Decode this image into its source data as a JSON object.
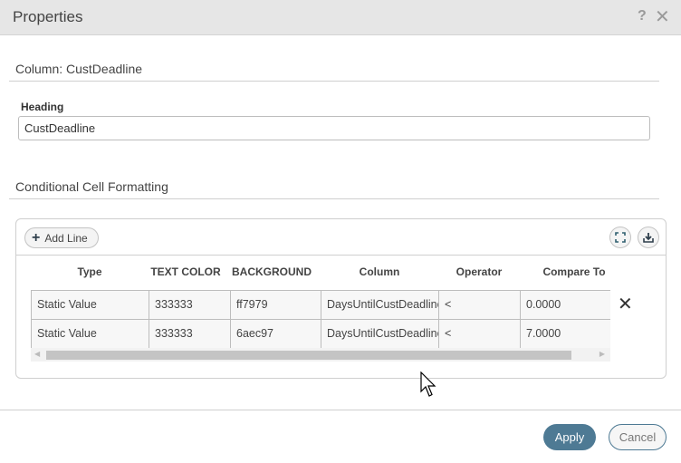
{
  "window": {
    "title": "Properties",
    "help_icon": "?",
    "close_icon": "✕"
  },
  "column_section": {
    "title": "Column: CustDeadline",
    "heading_label": "Heading",
    "heading_value": "CustDeadline"
  },
  "formatting_section": {
    "title": "Conditional Cell Formatting",
    "add_line_label": "Add Line",
    "add_line_icon": "+",
    "toolbar_icons": [
      "expand-icon",
      "download-icon"
    ],
    "columns": [
      "Type",
      "TEXT COLOR",
      "BACKGROUND",
      "Column",
      "Operator",
      "Compare To"
    ],
    "rows": [
      {
        "type": "Static Value",
        "text_color": "333333",
        "background": "ff7979",
        "column": "DaysUntilCustDeadline",
        "operator": "<",
        "compare_to": "0.0000"
      },
      {
        "type": "Static Value",
        "text_color": "333333",
        "background": "6aec97",
        "column": "DaysUntilCustDeadline",
        "operator": "<",
        "compare_to": "7.0000"
      }
    ],
    "delete_icon": "✕"
  },
  "footer": {
    "apply_label": "Apply",
    "cancel_label": "Cancel"
  },
  "colors": {
    "accent": "#4e7a94",
    "titlebar": "#e6e6e6"
  }
}
